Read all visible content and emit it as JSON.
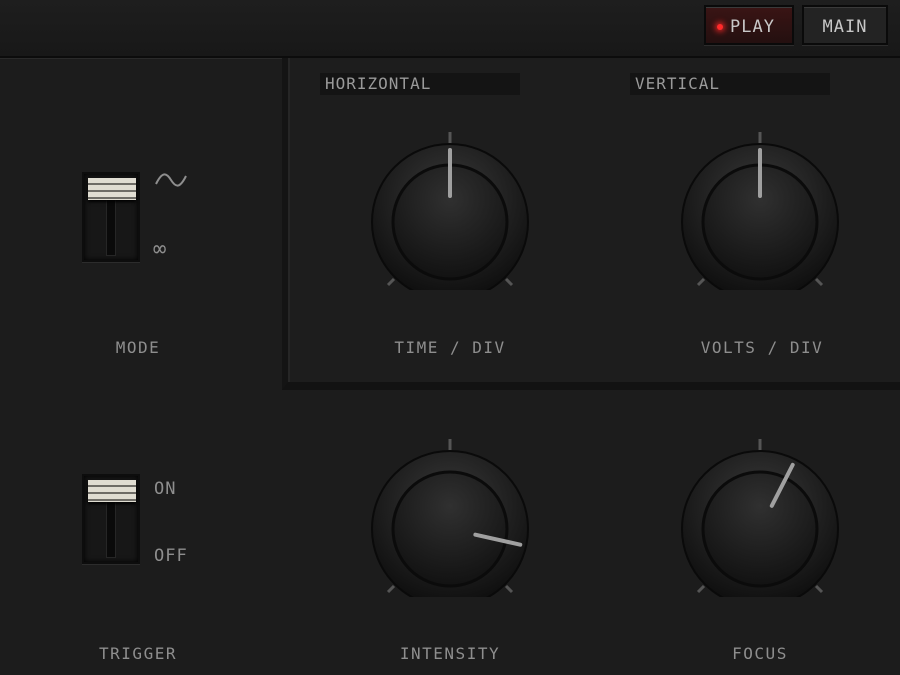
{
  "toolbar": {
    "play_label": "PLAY",
    "main_label": "MAIN",
    "led_color": "#ff2a2a"
  },
  "sections": {
    "horizontal": "HORIZONTAL",
    "vertical": "VERTICAL"
  },
  "knobs": {
    "time_div": {
      "label": "TIME / DIV",
      "value": 0.5
    },
    "volts_div": {
      "label": "VOLTS / DIV",
      "value": 0.5
    },
    "intensity": {
      "label": "INTENSITY",
      "value": 0.88
    },
    "focus": {
      "label": "FOCUS",
      "value": 0.6
    }
  },
  "switches": {
    "mode": {
      "label": "MODE",
      "options": [
        "~",
        "∞"
      ],
      "selected": "~"
    },
    "trigger": {
      "label": "TRIGGER",
      "options": [
        "ON",
        "OFF"
      ],
      "selected": "ON"
    }
  },
  "icons": {
    "mode_top": "sine-wave-icon",
    "mode_bottom": "infinity-icon"
  }
}
